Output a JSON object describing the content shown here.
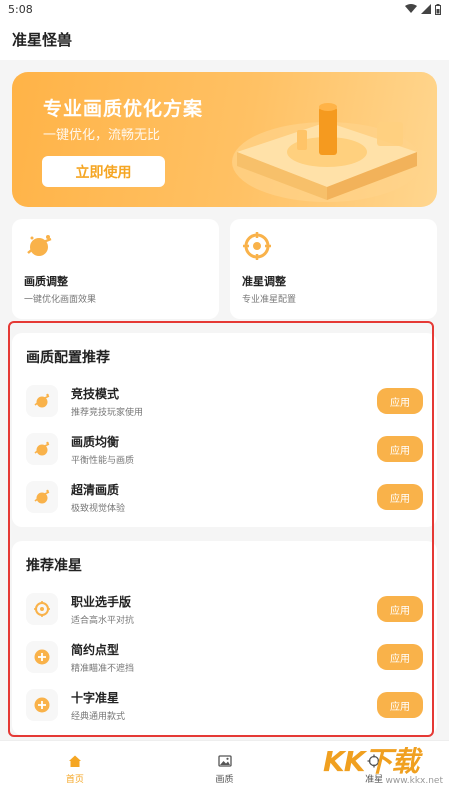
{
  "status_bar": {
    "time": "5:08"
  },
  "header": {
    "title": "准星怪兽"
  },
  "banner": {
    "title": "专业画质优化方案",
    "subtitle": "一键优化，流畅无比",
    "button": "立即使用"
  },
  "quick_cards": [
    {
      "title": "画质调整",
      "subtitle": "一键优化画面效果",
      "icon": "planet-icon"
    },
    {
      "title": "准星调整",
      "subtitle": "专业准星配置",
      "icon": "crosshair-icon"
    }
  ],
  "sections": [
    {
      "title": "画质配置推荐",
      "items": [
        {
          "name": "竞技模式",
          "desc": "推荐竞技玩家使用",
          "button": "应用",
          "icon": "planet-icon"
        },
        {
          "name": "画质均衡",
          "desc": "平衡性能与画质",
          "button": "应用",
          "icon": "planet-icon"
        },
        {
          "name": "超清画质",
          "desc": "极致视觉体验",
          "button": "应用",
          "icon": "planet-icon"
        }
      ]
    },
    {
      "title": "推荐准星",
      "items": [
        {
          "name": "职业选手版",
          "desc": "适合高水平对抗",
          "button": "应用",
          "icon": "crosshair-icon"
        },
        {
          "name": "简约点型",
          "desc": "精准瞄准不遮挡",
          "button": "应用",
          "icon": "plus-circle-icon"
        },
        {
          "name": "十字准星",
          "desc": "经典通用款式",
          "button": "应用",
          "icon": "plus-circle-icon"
        }
      ]
    }
  ],
  "bottom_nav": [
    {
      "label": "首页",
      "icon": "home-icon",
      "active": true
    },
    {
      "label": "画质",
      "icon": "image-icon",
      "active": false
    },
    {
      "label": "准星",
      "icon": "crosshair-icon",
      "active": false
    }
  ],
  "watermark": {
    "logo": "KK下载",
    "url": "www.kkx.net"
  },
  "colors": {
    "accent": "#f9b24a",
    "highlight_border": "#e53935"
  }
}
